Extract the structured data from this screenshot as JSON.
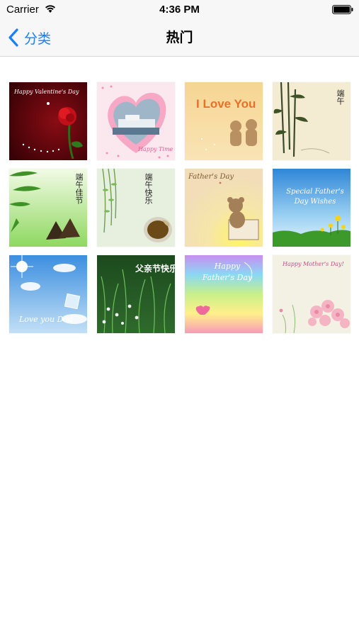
{
  "status_bar": {
    "carrier": "Carrier",
    "time": "4:36 PM"
  },
  "nav": {
    "back_label": "分类",
    "title": "热门"
  },
  "cards": [
    {
      "theme": "valentines-rose",
      "text": "Happy Valentine's Day"
    },
    {
      "theme": "heart-ship",
      "text": "Happy Time"
    },
    {
      "theme": "i-love-you-bears",
      "text": "I Love You"
    },
    {
      "theme": "bamboo-dragon-boat",
      "text": "端午"
    },
    {
      "theme": "bamboo-zongzi",
      "text": "端午佳节"
    },
    {
      "theme": "willow-tea",
      "text": "端午快乐"
    },
    {
      "theme": "fathers-day-bear",
      "text": "Father's Day"
    },
    {
      "theme": "sky-flowers",
      "text": "Special Father's Day Wishes"
    },
    {
      "theme": "sun-sky",
      "text": "Love you Dad"
    },
    {
      "theme": "grass-daisies",
      "text": "父亲节快乐"
    },
    {
      "theme": "rainbow",
      "text": "Happy Father's Day"
    },
    {
      "theme": "mothers-day-roses",
      "text": "Happy Mother's Day!"
    }
  ]
}
